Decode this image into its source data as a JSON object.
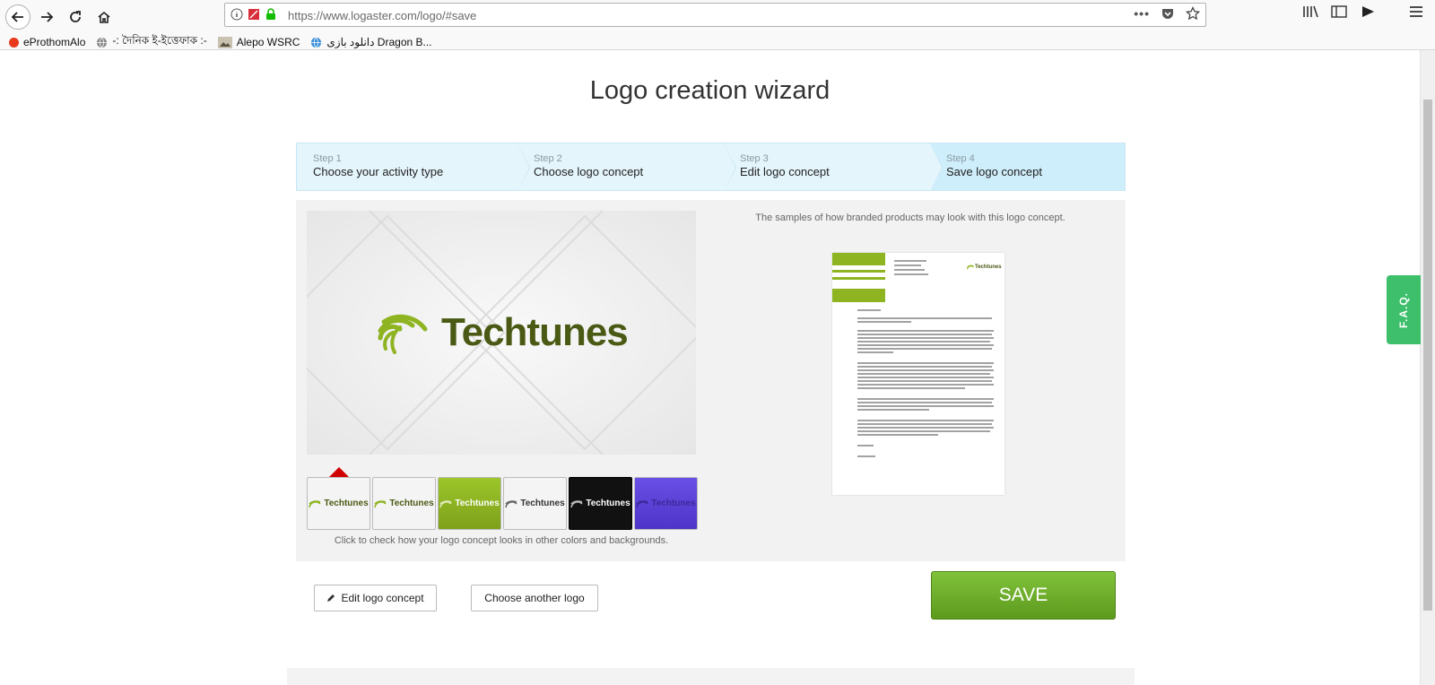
{
  "browser": {
    "url": "https://www.logaster.com/logo/#save",
    "bookmarks": [
      {
        "label": "eProthomAlo",
        "icon": "red-dot-icon"
      },
      {
        "label": "-: দৈনিক ই-ইত্তেফাক :-",
        "icon": "globe-icon"
      },
      {
        "label": "Alepo WSRC",
        "icon": "image-icon"
      },
      {
        "label": "دانلود بازی Dragon B...",
        "icon": "globe-icon"
      }
    ]
  },
  "page": {
    "title": "Logo creation wizard"
  },
  "steps": [
    {
      "num": "Step 1",
      "label": "Choose your activity type"
    },
    {
      "num": "Step 2",
      "label": "Choose logo concept"
    },
    {
      "num": "Step 3",
      "label": "Edit logo concept"
    },
    {
      "num": "Step 4",
      "label": "Save logo concept"
    }
  ],
  "preview": {
    "logo_text": "Techtunes",
    "samples_caption": "The samples of how branded products may look with this logo concept.",
    "hint": "Click to check how your logo concept looks in other colors and backgrounds."
  },
  "swatches": [
    {
      "label": "Techtunes",
      "bg": "#f4f4f4",
      "fg": "#4a5a14",
      "selected": true
    },
    {
      "label": "Techtunes",
      "bg": "#f4f4f4",
      "fg": "#4a5a14",
      "selected": false
    },
    {
      "label": "Techtunes",
      "bg": "#8fb422",
      "fg": "#ffffff",
      "selected": false
    },
    {
      "label": "Techtunes",
      "bg": "#f4f4f4",
      "fg": "#333333",
      "selected": false
    },
    {
      "label": "Techtunes",
      "bg": "#111111",
      "fg": "#ffffff",
      "selected": false
    },
    {
      "label": "Techtunes",
      "bg": "#5b3fd9",
      "fg": "#4a3fa0",
      "selected": false
    }
  ],
  "actions": {
    "edit_label": "Edit logo concept",
    "choose_label": "Choose another logo",
    "save_label": "SAVE"
  },
  "faq": "F.A.Q.",
  "colors": {
    "accent_green": "#6cab2a",
    "logo_green": "#8fb422",
    "logo_text": "#4a5a14",
    "pointer_red": "#d10000"
  }
}
